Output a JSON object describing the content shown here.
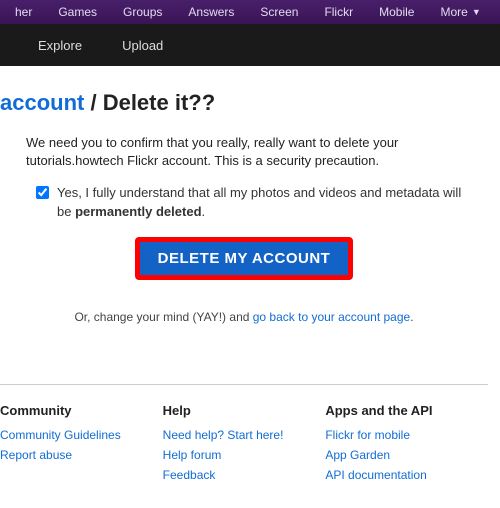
{
  "topnav": {
    "items": [
      "her",
      "Games",
      "Groups",
      "Answers",
      "Screen",
      "Flickr",
      "Mobile"
    ],
    "more": "More"
  },
  "subnav": {
    "items": [
      "Explore",
      "Upload"
    ]
  },
  "title": {
    "account": "account",
    "rest": " / Delete it??"
  },
  "confirm": "We need you to confirm that you really, really want to delete your tutorials.howtech Flickr account. This is a security precaution.",
  "checkbox": {
    "pre": "Yes, I fully understand that all my photos and videos and metadata will be ",
    "bold": "permanently deleted",
    "post": "."
  },
  "delete_button": "DELETE MY ACCOUNT",
  "change_mind": {
    "pre": "Or, change your mind (YAY!) and ",
    "link": "go back to your account page",
    "post": "."
  },
  "footer": {
    "cols": [
      {
        "heading": "Community",
        "links": [
          "Community Guidelines",
          "Report abuse"
        ]
      },
      {
        "heading": "Help",
        "links": [
          "Need help? Start here!",
          "Help forum",
          "Feedback"
        ]
      },
      {
        "heading": "Apps and the API",
        "links": [
          "Flickr for mobile",
          "App Garden",
          "API documentation"
        ]
      }
    ]
  }
}
